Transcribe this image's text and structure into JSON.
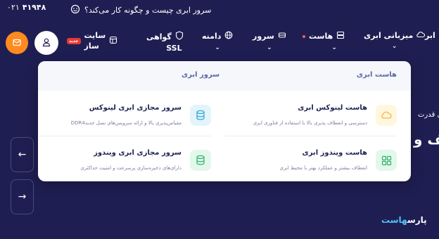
{
  "topbar": {
    "phone_number": "۴۱۹۴۸",
    "phone_prefix": "۰۲۱",
    "notice": "سرور ابری چیست و چگونه کار می‌کند؟"
  },
  "nav": {
    "items": [
      {
        "label": "ابر",
        "icon": "cloud-icon"
      },
      {
        "label": "میزبانی ابری",
        "icon": "cloud-icon"
      },
      {
        "label": "هاست",
        "icon": "server-stack-icon"
      },
      {
        "label": "سرور",
        "icon": "drive-icon"
      },
      {
        "label": "دامنه",
        "icon": "globe-icon"
      },
      {
        "label": "گواهی",
        "sublabel": "SSL",
        "icon": "shield-icon"
      },
      {
        "label": "سایت",
        "sublabel": "ساز",
        "icon": "site-builder-icon",
        "badge": "جدید"
      }
    ]
  },
  "dropdown": {
    "col_right_title": "هاست ابری",
    "col_left_title": "سرور ابری",
    "items": [
      {
        "title": "هاست لینوکس ابری",
        "desc": "دسترسی و انعطاف پذیری بالا با استفاده از فناوری ابری",
        "icon": "cloud-outline-icon",
        "icon_bg": "#fff6dd",
        "icon_color": "#f4b63f"
      },
      {
        "title": "سرور مجازی ابری لینوکس",
        "desc": "مقیاس‌پذیری بالا و ارائه سرویس‌های نسل جدیدDDR4",
        "icon": "database-icon",
        "icon_bg": "#e3f4fb",
        "icon_color": "#2fa6d6"
      },
      {
        "title": "هاست ویندوز ابری",
        "desc": "انعطاف بیشتر و عملکرد بهتر با محیط ابری",
        "icon": "grid-apps-icon",
        "icon_bg": "#e3f7ea",
        "icon_color": "#2fb36b"
      },
      {
        "title": "سرور مجازی ابری ویندوز",
        "desc": "دارای‌های ذخیره‌سازی پرسرعت و امنیت حداکثری",
        "icon": "database-icon",
        "icon_bg": "#e3f7ea",
        "icon_color": "#2fb36b"
      }
    ]
  },
  "hero": {
    "small_text": "برای قدرت",
    "big_text": "یف و"
  },
  "slider": {
    "prev_label": "←",
    "next_label": "→"
  },
  "footer": {
    "logo_main": "پارس",
    "logo_accent": "هاست"
  },
  "colors": {
    "background": "#1f1e52",
    "accent_orange": "#ff8a1f",
    "badge_red": "#e53935"
  }
}
